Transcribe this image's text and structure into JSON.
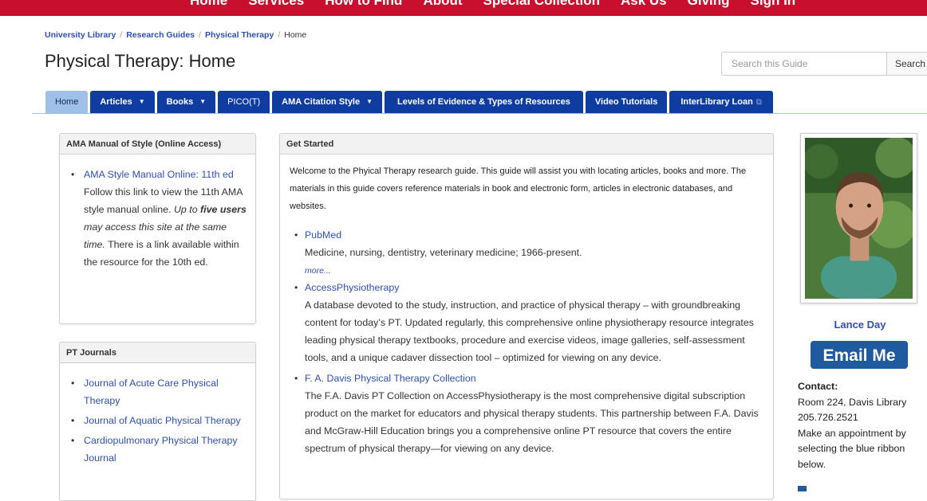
{
  "top_nav": {
    "items": [
      "Home",
      "Services",
      "How to Find",
      "About",
      "Special Collection",
      "Ask Us",
      "Giving",
      "Sign In"
    ]
  },
  "breadcrumb": {
    "items": [
      "University Library",
      "Research Guides",
      "Physical Therapy"
    ],
    "current": "Home"
  },
  "page": {
    "title": "Physical Therapy: Home"
  },
  "search": {
    "placeholder": "Search this Guide",
    "button_label": "Search"
  },
  "tabs": {
    "home": "Home",
    "articles": "Articles",
    "books": "Books",
    "pico": "PICO(T)",
    "ama": "AMA Citation Style",
    "levels": "Levels of Evidence & Types of Resources",
    "video": "Video Tutorials",
    "ill": "InterLibrary Loan"
  },
  "ama_box": {
    "title": "AMA Manual of Style (Online Access)",
    "link": "AMA Style Manual Online: 11th ed",
    "desc_1": "Follow this link to view the 11th AMA style manual online. ",
    "desc_italic_1": "Up to ",
    "desc_bold": "five users",
    "desc_italic_2": " may access this site at the same time.",
    "desc_2": " There is a link available within the resource for the 10th ed."
  },
  "journals_box": {
    "title": "PT Journals",
    "items": [
      "Journal of Acute Care Physical Therapy",
      "Journal of Aquatic Physical Therapy",
      "Cardiopulmonary Physical Therapy Journal"
    ]
  },
  "get_started": {
    "title": "Get Started",
    "intro": "Welcome to the Phyical Therapy research guide. This guide will assist you with locating articles, books and more. The materials in this guide covers reference materials in book and electronic form, articles in electronic databases, and websites.",
    "resources": [
      {
        "name": "PubMed",
        "desc": "Medicine, nursing, dentistry, veterinary medicine; 1966-present.",
        "more": "more..."
      },
      {
        "name": "AccessPhysiotherapy",
        "desc": "A database devoted to the study, instruction, and practice of physical therapy – with groundbreaking content for today’s PT. Updated regularly, this comprehensive online physiotherapy resource integrates leading physical therapy textbooks, procedure and exercise videos, image galleries, self-assessment tools, and a unique cadaver dissection tool – optimized for viewing on any device."
      },
      {
        "name": "F. A. Davis Physical Therapy Collection",
        "desc": "The F.A. Davis PT Collection on AccessPhysiotherapy is the most comprehensive digital subscription product on the market for educators and physical therapy students. This partnership between F.A. Davis and McGraw-Hill Education brings you a comprehensive online PT resource that covers the entire spectrum of physical therapy—for viewing on any device."
      }
    ]
  },
  "profile": {
    "name": "Lance Day",
    "email_label": "Email Me",
    "contact_label": "Contact:",
    "room": "Room 224, Davis Library",
    "phone": "205.726.2521",
    "appointment": "Make an appointment by selecting the blue ribbon below."
  },
  "colors": {
    "top_bar": "#c8102e",
    "tab_blue": "#0f3ca0",
    "tab_active": "#9fc0e8",
    "link": "#2f4fb5",
    "email_button": "#1f5aa0"
  }
}
